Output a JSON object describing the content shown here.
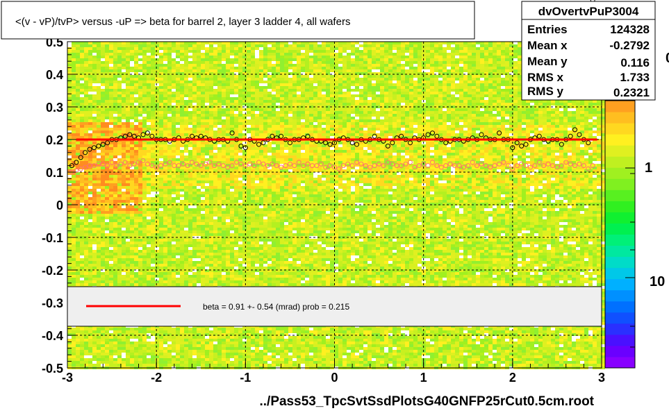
{
  "title": "<(v - vP)/tvP> versus  -uP => beta for barrel 2, layer 3 ladder 4, all wafers",
  "footer": "../Pass53_TpcSvtSsdPlotsG40GNFP25rCut0.5cm.root",
  "stats": {
    "name": "dvOvertvPuP3004",
    "rows": [
      {
        "label": "Entries",
        "value": "124328"
      },
      {
        "label": "Mean x",
        "value": "-0.2792"
      },
      {
        "label": "Mean y",
        "value": "0.116"
      },
      {
        "label": "RMS x",
        "value": "1.733"
      },
      {
        "label": "RMS y",
        "value": "0.2321"
      }
    ]
  },
  "legend": {
    "fit_label": "beta =    0.91 +-  0.54 (mrad) prob = 0.215",
    "line_color": "#ff0000"
  },
  "colorbar": {
    "labels": [
      "1",
      "10"
    ],
    "partial_label": "0",
    "colors": [
      "#8800ff",
      "#6a00ff",
      "#4a10ff",
      "#2a30ff",
      "#1050ff",
      "#0070ff",
      "#0090ff",
      "#00b0ff",
      "#00c8e8",
      "#00dcc8",
      "#00e8a0",
      "#00f078",
      "#00f050",
      "#10f030",
      "#30f020",
      "#58f020",
      "#80f020",
      "#a0f020",
      "#c0f020",
      "#e0f020",
      "#fff020",
      "#ffd820",
      "#ffbe20",
      "#ffa020"
    ]
  },
  "colors": {
    "hist_base": "#c8f020",
    "hist_dense": "#ff8c20",
    "fit_line": "#ff0000",
    "mean_points": "#000000",
    "secondary_points": "#ff7070"
  },
  "chart_data": {
    "type": "heatmap",
    "xlabel": "",
    "ylabel": "",
    "xlim": [
      -3,
      3
    ],
    "ylim": [
      -0.5,
      0.5
    ],
    "x_ticks": [
      "-3",
      "-2",
      "-1",
      "0",
      "1",
      "2",
      "3"
    ],
    "y_ticks": [
      "-0.5",
      "-0.4",
      "-0.3",
      "-0.2",
      "-0.1",
      "0",
      "0.1",
      "0.2",
      "0.3",
      "0.4",
      "0.5"
    ],
    "grid": true,
    "fit": {
      "type": "line",
      "y0": 0.2,
      "x_range": [
        -2.9,
        2.95
      ],
      "beta_mrad": 0.91,
      "beta_err_mrad": 0.54,
      "prob": 0.215
    },
    "profile_means": {
      "x": [
        -2.95,
        -2.9,
        -2.85,
        -2.8,
        -2.75,
        -2.7,
        -2.65,
        -2.6,
        -2.55,
        -2.5,
        -2.45,
        -2.4,
        -2.35,
        -2.3,
        -2.25,
        -2.2,
        -2.15,
        -2.1,
        -2.05,
        -2.0,
        -1.95,
        -1.9,
        -1.85,
        -1.8,
        -1.75,
        -1.7,
        -1.65,
        -1.6,
        -1.55,
        -1.5,
        -1.45,
        -1.4,
        -1.35,
        -1.3,
        -1.25,
        -1.2,
        -1.15,
        -1.1,
        -1.05,
        -1.0,
        -0.95,
        -0.9,
        -0.85,
        -0.8,
        -0.75,
        -0.7,
        -0.65,
        -0.6,
        -0.55,
        -0.5,
        -0.45,
        -0.4,
        -0.35,
        -0.3,
        -0.25,
        -0.2,
        -0.15,
        -0.1,
        -0.05,
        0.0,
        0.05,
        0.1,
        0.15,
        0.2,
        0.25,
        0.3,
        0.35,
        0.4,
        0.45,
        0.5,
        0.55,
        0.6,
        0.65,
        0.7,
        0.75,
        0.8,
        0.85,
        0.9,
        0.95,
        1.0,
        1.05,
        1.1,
        1.15,
        1.2,
        1.25,
        1.3,
        1.35,
        1.4,
        1.45,
        1.5,
        1.55,
        1.6,
        1.65,
        1.7,
        1.75,
        1.8,
        1.85,
        1.9,
        1.95,
        2.0,
        2.05,
        2.1,
        2.15,
        2.2,
        2.25,
        2.3,
        2.35,
        2.4,
        2.45,
        2.5,
        2.55,
        2.6,
        2.65,
        2.7,
        2.75,
        2.8,
        2.85,
        2.9
      ],
      "y": [
        0.12,
        0.13,
        0.145,
        0.16,
        0.17,
        0.175,
        0.18,
        0.185,
        0.19,
        0.2,
        0.2,
        0.205,
        0.21,
        0.215,
        0.21,
        0.205,
        0.215,
        0.22,
        0.21,
        0.2,
        0.2,
        0.2,
        0.195,
        0.2,
        0.205,
        0.195,
        0.2,
        0.21,
        0.205,
        0.21,
        0.205,
        0.2,
        0.195,
        0.2,
        0.2,
        0.195,
        0.22,
        0.2,
        0.18,
        0.175,
        0.2,
        0.195,
        0.185,
        0.19,
        0.2,
        0.21,
        0.205,
        0.21,
        0.2,
        0.19,
        0.2,
        0.2,
        0.205,
        0.21,
        0.2,
        0.195,
        0.195,
        0.19,
        0.185,
        0.19,
        0.2,
        0.205,
        0.2,
        0.19,
        0.185,
        0.2,
        0.195,
        0.2,
        0.21,
        0.2,
        0.195,
        0.18,
        0.19,
        0.205,
        0.21,
        0.2,
        0.19,
        0.205,
        0.2,
        0.205,
        0.215,
        0.22,
        0.21,
        0.2,
        0.19,
        0.195,
        0.2,
        0.2,
        0.195,
        0.2,
        0.205,
        0.2,
        0.215,
        0.205,
        0.2,
        0.2,
        0.22,
        0.2,
        0.2,
        0.175,
        0.19,
        0.18,
        0.185,
        0.2,
        0.205,
        0.21,
        0.2,
        0.195,
        0.2,
        0.2,
        0.185,
        0.2,
        0.21,
        0.23,
        0.215,
        0.2,
        0.19
      ]
    },
    "profile_secondary": {
      "x": [
        -2.95,
        -2.9,
        -2.85,
        -2.8,
        -2.75,
        -2.7,
        -2.65,
        -2.6,
        -2.55,
        -2.5,
        -2.45,
        -2.4,
        -2.35,
        -2.3,
        -2.25,
        -2.2,
        -2.15,
        -2.1,
        -2.05,
        -2.0,
        -1.95,
        -1.9,
        -1.85,
        -1.8,
        -1.75,
        -1.7,
        -1.65,
        -1.6,
        -1.55,
        -1.5,
        -1.45,
        -1.4,
        -1.35,
        -1.3,
        -1.25,
        -1.2,
        -1.15,
        -1.1,
        -1.05,
        -1.0,
        -0.95,
        -0.9,
        -0.85,
        -0.8,
        -0.75,
        -0.7,
        -0.65,
        -0.6,
        -0.55,
        -0.5,
        -0.45,
        -0.4,
        -0.35,
        -0.3,
        -0.25,
        -0.2,
        -0.15,
        -0.1,
        -0.05,
        0.0,
        0.05,
        0.1,
        0.15,
        0.2,
        0.25,
        0.3,
        0.35,
        0.4,
        0.45,
        0.5,
        0.55,
        0.6,
        0.65,
        0.7,
        0.75,
        0.8,
        0.85,
        0.9,
        0.95,
        1.0,
        1.05,
        1.1,
        1.15,
        1.2,
        1.25,
        1.3,
        1.35,
        1.4,
        1.45,
        1.5,
        1.55,
        1.6,
        1.65,
        1.7,
        1.75,
        1.8,
        1.85,
        1.9,
        1.95,
        2.0,
        2.05,
        2.1,
        2.15,
        2.2,
        2.25,
        2.3,
        2.35,
        2.4,
        2.45,
        2.5,
        2.55,
        2.6,
        2.65,
        2.7,
        2.75,
        2.8,
        2.85,
        2.9
      ],
      "y": [
        0.1,
        0.105,
        0.11,
        0.115,
        0.12,
        0.12,
        0.125,
        0.125,
        0.12,
        0.13,
        0.12,
        0.125,
        0.13,
        0.12,
        0.125,
        0.13,
        0.135,
        0.125,
        0.12,
        0.115,
        0.12,
        0.125,
        0.13,
        0.12,
        0.12,
        0.125,
        0.12,
        0.13,
        0.125,
        0.12,
        0.125,
        0.13,
        0.12,
        0.125,
        0.12,
        0.115,
        0.12,
        0.13,
        0.125,
        0.12,
        0.125,
        0.12,
        0.13,
        0.125,
        0.12,
        0.125,
        0.12,
        0.115,
        0.12,
        0.125,
        0.12,
        0.13,
        0.12,
        0.125,
        0.12,
        0.12,
        0.125,
        0.115,
        0.12,
        0.115,
        0.11,
        0.12,
        0.125,
        0.12,
        0.13,
        0.125,
        0.12,
        0.115,
        0.12,
        0.125,
        0.12,
        0.13,
        0.125,
        0.12,
        0.12,
        0.125,
        0.13,
        0.115,
        0.12,
        0.125,
        0.12,
        0.13,
        0.12,
        0.115,
        0.12,
        0.125,
        0.12,
        0.12,
        0.115,
        0.12,
        0.13,
        0.12,
        0.125,
        0.12,
        0.115,
        0.12,
        0.125,
        0.13,
        0.12,
        0.11,
        0.12,
        0.125,
        0.12,
        0.115,
        0.12,
        0.13,
        0.12,
        0.125,
        0.12,
        0.115,
        0.12,
        0.13,
        0.125,
        0.12,
        0.125,
        0.12,
        0.11,
        0.12
      ]
    }
  }
}
